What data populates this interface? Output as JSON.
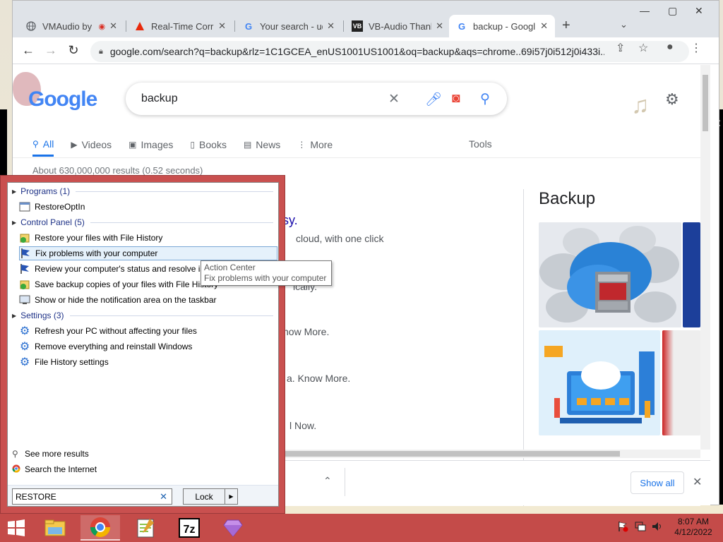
{
  "browser": {
    "tabs": [
      {
        "label": "VMAudio by",
        "icon": "globe-icon"
      },
      {
        "label": "Real-Time Corru",
        "icon": "warning-triangle-icon"
      },
      {
        "label": "Your search - ud",
        "icon": "google-g-icon"
      },
      {
        "label": "VB-Audio Thank",
        "icon": "vb-logo-icon"
      },
      {
        "label": "backup - Googl",
        "icon": "google-g-icon",
        "active": true
      }
    ],
    "new_tab": "+",
    "url": "google.com/search?q=backup&rlz=1C1GCEA_enUS1001US1001&oq=backup&aqs=chrome..69i57j0i512j0i433i..."
  },
  "google": {
    "logo_text": "Google",
    "query": "backup",
    "tabs": [
      {
        "label": "All",
        "icon": "search-icon",
        "active": true
      },
      {
        "label": "Videos",
        "icon": "video-icon"
      },
      {
        "label": "Images",
        "icon": "image-icon"
      },
      {
        "label": "Books",
        "icon": "book-icon"
      },
      {
        "label": "News",
        "icon": "news-icon"
      },
      {
        "label": "More",
        "icon": "more-vertical-icon"
      }
    ],
    "tools": "Tools",
    "result_stats": "About 630,000,000 results (0.52 seconds)",
    "fragments": {
      "f1": "sy.",
      "f2": "cloud, with one click",
      "f3": "ically.",
      "f4": "now More.",
      "f5": "a. Know More.",
      "f6": "l Now."
    },
    "knowledge_panel_title": "Backup"
  },
  "downloads": {
    "show_all": "Show all"
  },
  "start_menu": {
    "groups": {
      "programs": "Programs (1)",
      "control_panel": "Control Panel (5)",
      "settings": "Settings (3)"
    },
    "programs": [
      "RestoreOptIn"
    ],
    "control_panel": [
      "Restore your files with File History",
      "Fix problems with your computer",
      "Review your computer's status and resolve issues",
      "Save backup copies of your files with File History",
      "Show or hide the notification area on the taskbar"
    ],
    "settings": [
      "Refresh your PC without affecting your files",
      "Remove everything and reinstall Windows",
      "File History settings"
    ],
    "see_more": "See more results",
    "search_internet": "Search the Internet",
    "search_value": "RESTORE",
    "lock_label": "Lock"
  },
  "tooltip": {
    "title": "Action Center",
    "body": "Fix problems with your computer"
  },
  "taskbar": {
    "time": "8:07 AM",
    "date": "4/12/2022"
  },
  "colors": {
    "taskbar": "#c44b49",
    "start_menu_border": "#c9504f",
    "link_blue": "#1a73e8"
  }
}
